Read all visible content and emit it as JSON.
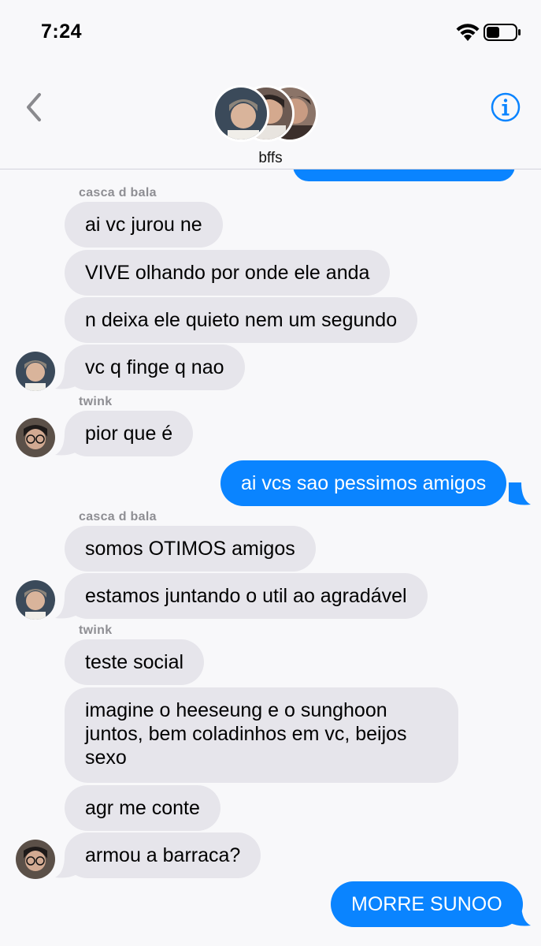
{
  "status": {
    "time": "7:24"
  },
  "header": {
    "group_name": "bffs"
  },
  "messages": [
    {
      "sender": "casca d bala"
    },
    {
      "text": "ai vc jurou ne"
    },
    {
      "text": "VIVE olhando por onde ele anda"
    },
    {
      "text": "n deixa ele quieto nem um segundo"
    },
    {
      "text": "vc q finge q nao"
    },
    {
      "sender": "twink"
    },
    {
      "text": "pior que é"
    },
    {
      "text": "ai vcs sao pessimos amigos"
    },
    {
      "sender": "casca d bala"
    },
    {
      "text": "somos OTIMOS amigos"
    },
    {
      "text": "estamos juntando o util ao agradável"
    },
    {
      "sender": "twink"
    },
    {
      "text": "teste social"
    },
    {
      "text": "imagine o heeseung e o sunghoon juntos, bem coladinhos em vc, beijos sexo"
    },
    {
      "text": "agr me conte"
    },
    {
      "text": "armou a barraca?"
    },
    {
      "text": "MORRE SUNOO"
    }
  ],
  "colors": {
    "sent_bubble": "#0a84ff",
    "received_bubble": "#e6e5eb",
    "accent": "#0a84ff"
  }
}
